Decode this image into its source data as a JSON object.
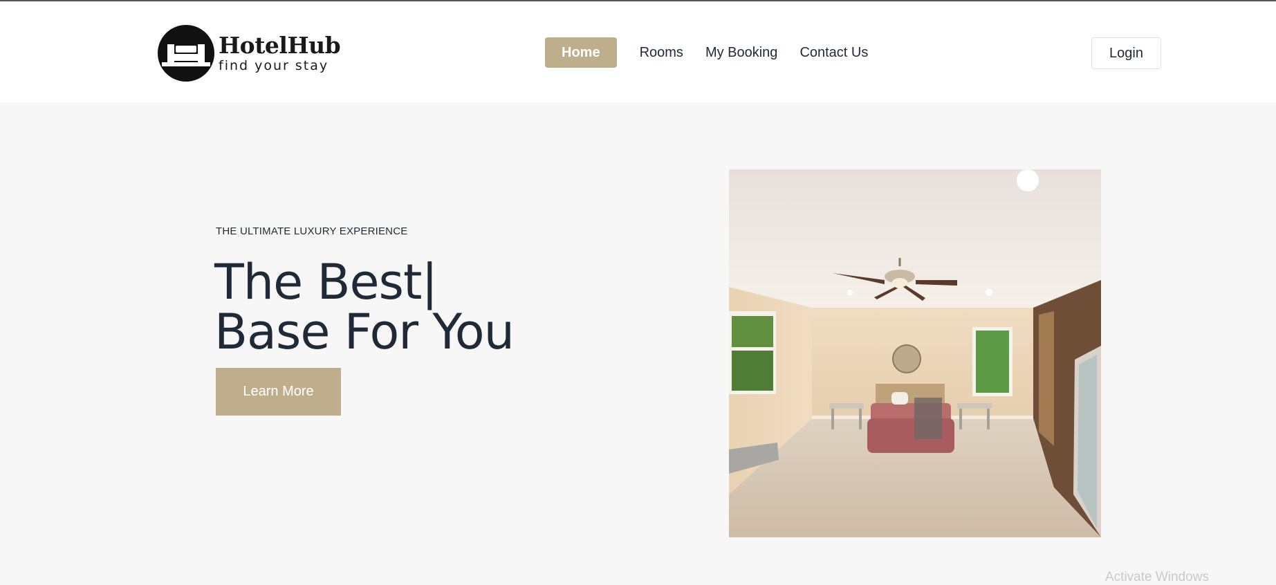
{
  "brand": {
    "name": "HotelHub",
    "tagline": "find your stay",
    "logo_icon": "bed-icon"
  },
  "nav": {
    "items": [
      {
        "label": "Home",
        "active": true
      },
      {
        "label": "Rooms",
        "active": false
      },
      {
        "label": "My Booking",
        "active": false
      },
      {
        "label": "Contact Us",
        "active": false
      }
    ],
    "login_label": "Login"
  },
  "hero": {
    "eyebrow": "THE ULTIMATE LUXURY EXPERIENCE",
    "title_line1": "The Best|",
    "title_line2": "Base For You",
    "cta_label": "Learn More",
    "image_subject": "bedroom-photo"
  },
  "system": {
    "watermark": "Activate Windows"
  },
  "colors": {
    "accent": "#bfae8c",
    "text": "#1f2937",
    "background": "#f7f7f7",
    "header": "#ffffff"
  }
}
